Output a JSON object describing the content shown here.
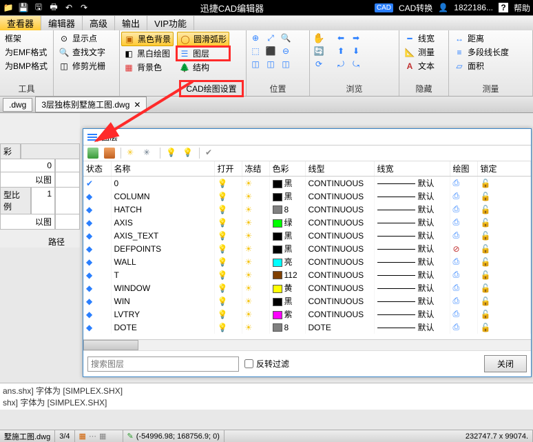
{
  "titlebar": {
    "title": "迅捷CAD编辑器",
    "convert": "CAD转换",
    "user": "1822186...",
    "help": "帮助"
  },
  "menu": {
    "tabs": [
      "查看器",
      "编辑器",
      "高级",
      "输出",
      "VIP功能"
    ]
  },
  "ribbon": {
    "g1": {
      "items": [
        "框架",
        "为EMF格式",
        "为BMP格式"
      ],
      "label": "工具"
    },
    "g2": {
      "items": [
        "显示点",
        "查找文字",
        "修剪光栅"
      ]
    },
    "g3": {
      "items": [
        "黑色背景",
        "黑白绘图",
        "背景色"
      ]
    },
    "g4": {
      "items": [
        "圆滑弧形",
        "图层",
        "结构"
      ],
      "label": "CAD绘图设置"
    },
    "g5": {
      "label": "位置"
    },
    "g6": {
      "label": "浏览"
    },
    "g7": {
      "items": [
        "线宽",
        "测量",
        "文本"
      ],
      "label": "隐藏"
    },
    "g8": {
      "items": [
        "距离",
        "多段线长度",
        "面积"
      ],
      "label": "测量"
    }
  },
  "tabs": {
    "file1": ".dwg",
    "file2": "3层独栋别墅施工图.dwg"
  },
  "leftpanel": {
    "zero": "0",
    "yitu1": "以图",
    "ratio_label": "型比例",
    "one": "1",
    "yitu2": "以图",
    "path": "路径"
  },
  "dialog": {
    "title": "图层",
    "headers": {
      "status": "状态",
      "name": "名称",
      "open": "打开",
      "freeze": "冻结",
      "color": "色彩",
      "linetype": "线型",
      "lineweight": "线宽",
      "plot": "绘图",
      "lock": "锁定"
    },
    "rows": [
      {
        "name": "0",
        "open": true,
        "color": "#000000",
        "colorLabel": "黑",
        "linetype": "CONTINUOUS",
        "lw": "默认",
        "plot": true
      },
      {
        "name": "COLUMN",
        "open": true,
        "color": "#000000",
        "colorLabel": "黑",
        "linetype": "CONTINUOUS",
        "lw": "默认",
        "plot": true
      },
      {
        "name": "HATCH",
        "open": true,
        "color": "#808080",
        "colorLabel": "8",
        "linetype": "CONTINUOUS",
        "lw": "默认",
        "plot": true
      },
      {
        "name": "AXIS",
        "open": true,
        "color": "#00ff00",
        "colorLabel": "绿",
        "linetype": "CONTINUOUS",
        "lw": "默认",
        "plot": true
      },
      {
        "name": "AXIS_TEXT",
        "open": true,
        "color": "#000000",
        "colorLabel": "黑",
        "linetype": "CONTINUOUS",
        "lw": "默认",
        "plot": true
      },
      {
        "name": "DEFPOINTS",
        "open": false,
        "color": "#000000",
        "colorLabel": "黑",
        "linetype": "CONTINUOUS",
        "lw": "默认",
        "plot": false
      },
      {
        "name": "WALL",
        "open": true,
        "color": "#00ffff",
        "colorLabel": "亮",
        "linetype": "CONTINUOUS",
        "lw": "默认",
        "plot": true
      },
      {
        "name": "T",
        "open": true,
        "color": "#804000",
        "colorLabel": "112",
        "linetype": "CONTINUOUS",
        "lw": "默认",
        "plot": true
      },
      {
        "name": "WINDOW",
        "open": true,
        "color": "#ffff00",
        "colorLabel": "黄",
        "linetype": "CONTINUOUS",
        "lw": "默认",
        "plot": true
      },
      {
        "name": "WIN",
        "open": true,
        "color": "#000000",
        "colorLabel": "黑",
        "linetype": "CONTINUOUS",
        "lw": "默认",
        "plot": true
      },
      {
        "name": "LVTRY",
        "open": true,
        "color": "#ff00ff",
        "colorLabel": "紫",
        "linetype": "CONTINUOUS",
        "lw": "默认",
        "plot": true
      },
      {
        "name": "DOTE",
        "open": true,
        "color": "#808080",
        "colorLabel": "8",
        "linetype": "DOTE",
        "lw": "默认",
        "plot": true
      }
    ],
    "search_placeholder": "搜索图层",
    "invert_filter": "反转过滤",
    "close": "关闭"
  },
  "log": {
    "line1": "ans.shx] 字体为 [SIMPLEX.SHX]",
    "line2": "shx] 字体为 [SIMPLEX.SHX]"
  },
  "status": {
    "file": "墅施工图.dwg",
    "page": "3/4",
    "coords": "(-54996.98; 168756.9; 0)",
    "right": "232747.7 x 99074."
  }
}
